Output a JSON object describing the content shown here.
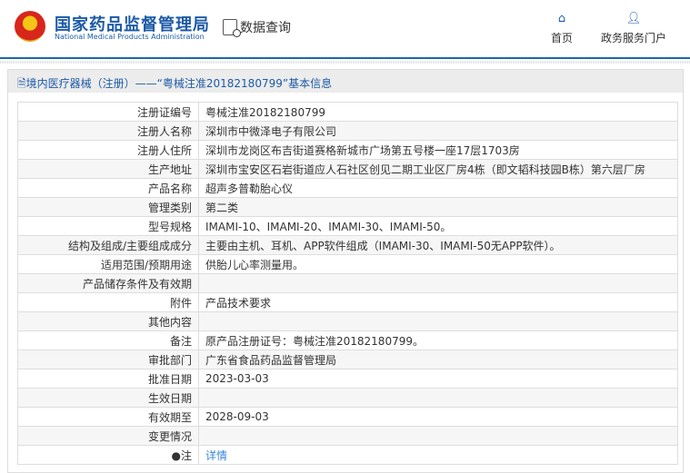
{
  "header": {
    "title_cn": "国家药品监督管理局",
    "title_en": "National Medical Products Administration",
    "query": "数据查询",
    "nav": [
      {
        "label": "首页",
        "icon": "home-icon"
      },
      {
        "label": "政务服务门户",
        "icon": "user-icon"
      }
    ]
  },
  "panel": {
    "title": "境内医疗器械（注册）——“粤械注准20182180799”基本信息"
  },
  "rows": [
    {
      "k": "注册证编号",
      "v": "粤械注准20182180799"
    },
    {
      "k": "注册人名称",
      "v": "深圳市中微泽电子有限公司"
    },
    {
      "k": "注册人住所",
      "v": "深圳市龙岗区布吉街道赛格新城市广场第五号楼一座17层1703房"
    },
    {
      "k": "生产地址",
      "v": "深圳市宝安区石岩街道应人石社区创见二期工业区厂房4栋（即文韬科技园B栋）第六层厂房"
    },
    {
      "k": "产品名称",
      "v": "超声多普勒胎心仪"
    },
    {
      "k": "管理类别",
      "v": "第二类"
    },
    {
      "k": "型号规格",
      "v": "IMAMI-10、IMAMI-20、IMAMI-30、IMAMI-50。"
    },
    {
      "k": "结构及组成/主要组成成分",
      "v": "主要由主机、耳机、APP软件组成（IMAMI-30、IMAMI-50无APP软件）。"
    },
    {
      "k": "适用范围/预期用途",
      "v": "供胎儿心率测量用。"
    },
    {
      "k": "产品储存条件及有效期",
      "v": ""
    },
    {
      "k": "附件",
      "v": "产品技术要求"
    },
    {
      "k": "其他内容",
      "v": ""
    },
    {
      "k": "备注",
      "v": "原产品注册证号：粤械注准20182180799。"
    },
    {
      "k": "审批部门",
      "v": "广东省食品药品监督管理局"
    },
    {
      "k": "批准日期",
      "v": "2023-03-03"
    },
    {
      "k": "生效日期",
      "v": ""
    },
    {
      "k": "有效期至",
      "v": "2028-09-03"
    },
    {
      "k": "变更情况",
      "v": ""
    }
  ],
  "note": {
    "k": "注",
    "v": "详情"
  }
}
